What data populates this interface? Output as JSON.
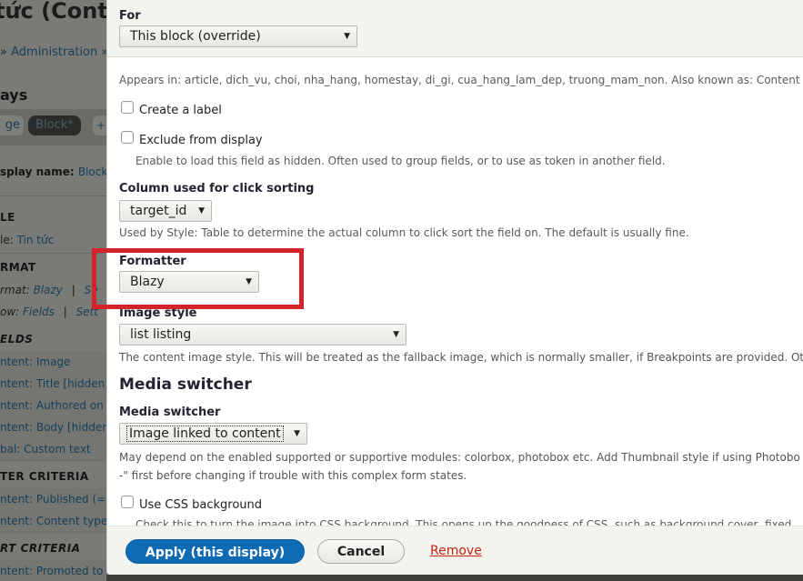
{
  "background_page": {
    "title_fragment": "tức (Conte",
    "breadcrumb": {
      "separator": "»",
      "link": "Administration",
      "trailing": "»"
    },
    "displays_heading": "ays",
    "tabs": [
      {
        "label": "ge"
      },
      {
        "label": "Block*",
        "active": true
      },
      {
        "label": "+"
      }
    ],
    "display_name": {
      "label": "splay name:",
      "value": "Block"
    },
    "title_section": {
      "heading": "LE",
      "label": "le:",
      "value": "Tin tức"
    },
    "format_section": {
      "heading": "RMAT",
      "format_label": "rmat:",
      "format_value": "Blazy",
      "format_settings": "Se",
      "show_label": "ow:",
      "show_value": "Fields",
      "show_settings": "Sett"
    },
    "fields_section": {
      "heading": "ELDS",
      "items": [
        "ntent: Image",
        "ntent: Title [hidden]",
        "ntent: Authored on",
        "ntent: Body [hidden",
        "bal: Custom text"
      ]
    },
    "filter_section": {
      "heading": "TER CRITERIA",
      "items": [
        "ntent: Published (=",
        "ntent: Content type"
      ]
    },
    "sort_section": {
      "heading": "RT CRITERIA",
      "items": [
        "ntent: Promoted to"
      ]
    }
  },
  "dialog": {
    "for_label": "For",
    "for_select": "This block (override)",
    "appears_in": "Appears in: article, dich_vu, choi, nha_hang, homestay, di_gi, cua_hang_lam_dep, truong_mam_non. Also known as: Content",
    "create_label": {
      "label": "Create a label",
      "checked": false
    },
    "exclude": {
      "label": "Exclude from display",
      "checked": false,
      "description": "Enable to load this field as hidden. Often used to group fields, or to use as token in another field."
    },
    "click_sort": {
      "label": "Column used for click sorting",
      "value": "target_id",
      "description": "Used by Style: Table to determine the actual column to click sort the field on. The default is usually fine."
    },
    "formatter": {
      "label": "Formatter",
      "value": "Blazy"
    },
    "image_style": {
      "label": "Image style",
      "value": "list listing",
      "description": "The content image style. This will be treated as the fallback image, which is normally smaller, if Breakpoints are provided. Ot"
    },
    "media_switcher_heading": "Media switcher",
    "media_switcher": {
      "label": "Media switcher",
      "value": "Image linked to content",
      "description_line1": "May depend on the enabled supported or supportive modules: colorbox, photobox etc. Add Thumbnail style if using Photobo",
      "description_line2": "-\" first before changing if trouble with this complex form states."
    },
    "css_background": {
      "label": "Use CSS background",
      "checked": false,
      "description": "Check this to turn the image into CSS background. This opens up the goodness of CSS, such as background cover, fixed"
    },
    "buttons": {
      "apply": "Apply (this display)",
      "cancel": "Cancel",
      "remove": "Remove"
    }
  },
  "colors": {
    "primary_button": "#0f6ab4",
    "danger_link": "#c4250f",
    "highlight_annotation": "#d5232a"
  },
  "icons": {
    "dropdown_arrow": "▼"
  }
}
